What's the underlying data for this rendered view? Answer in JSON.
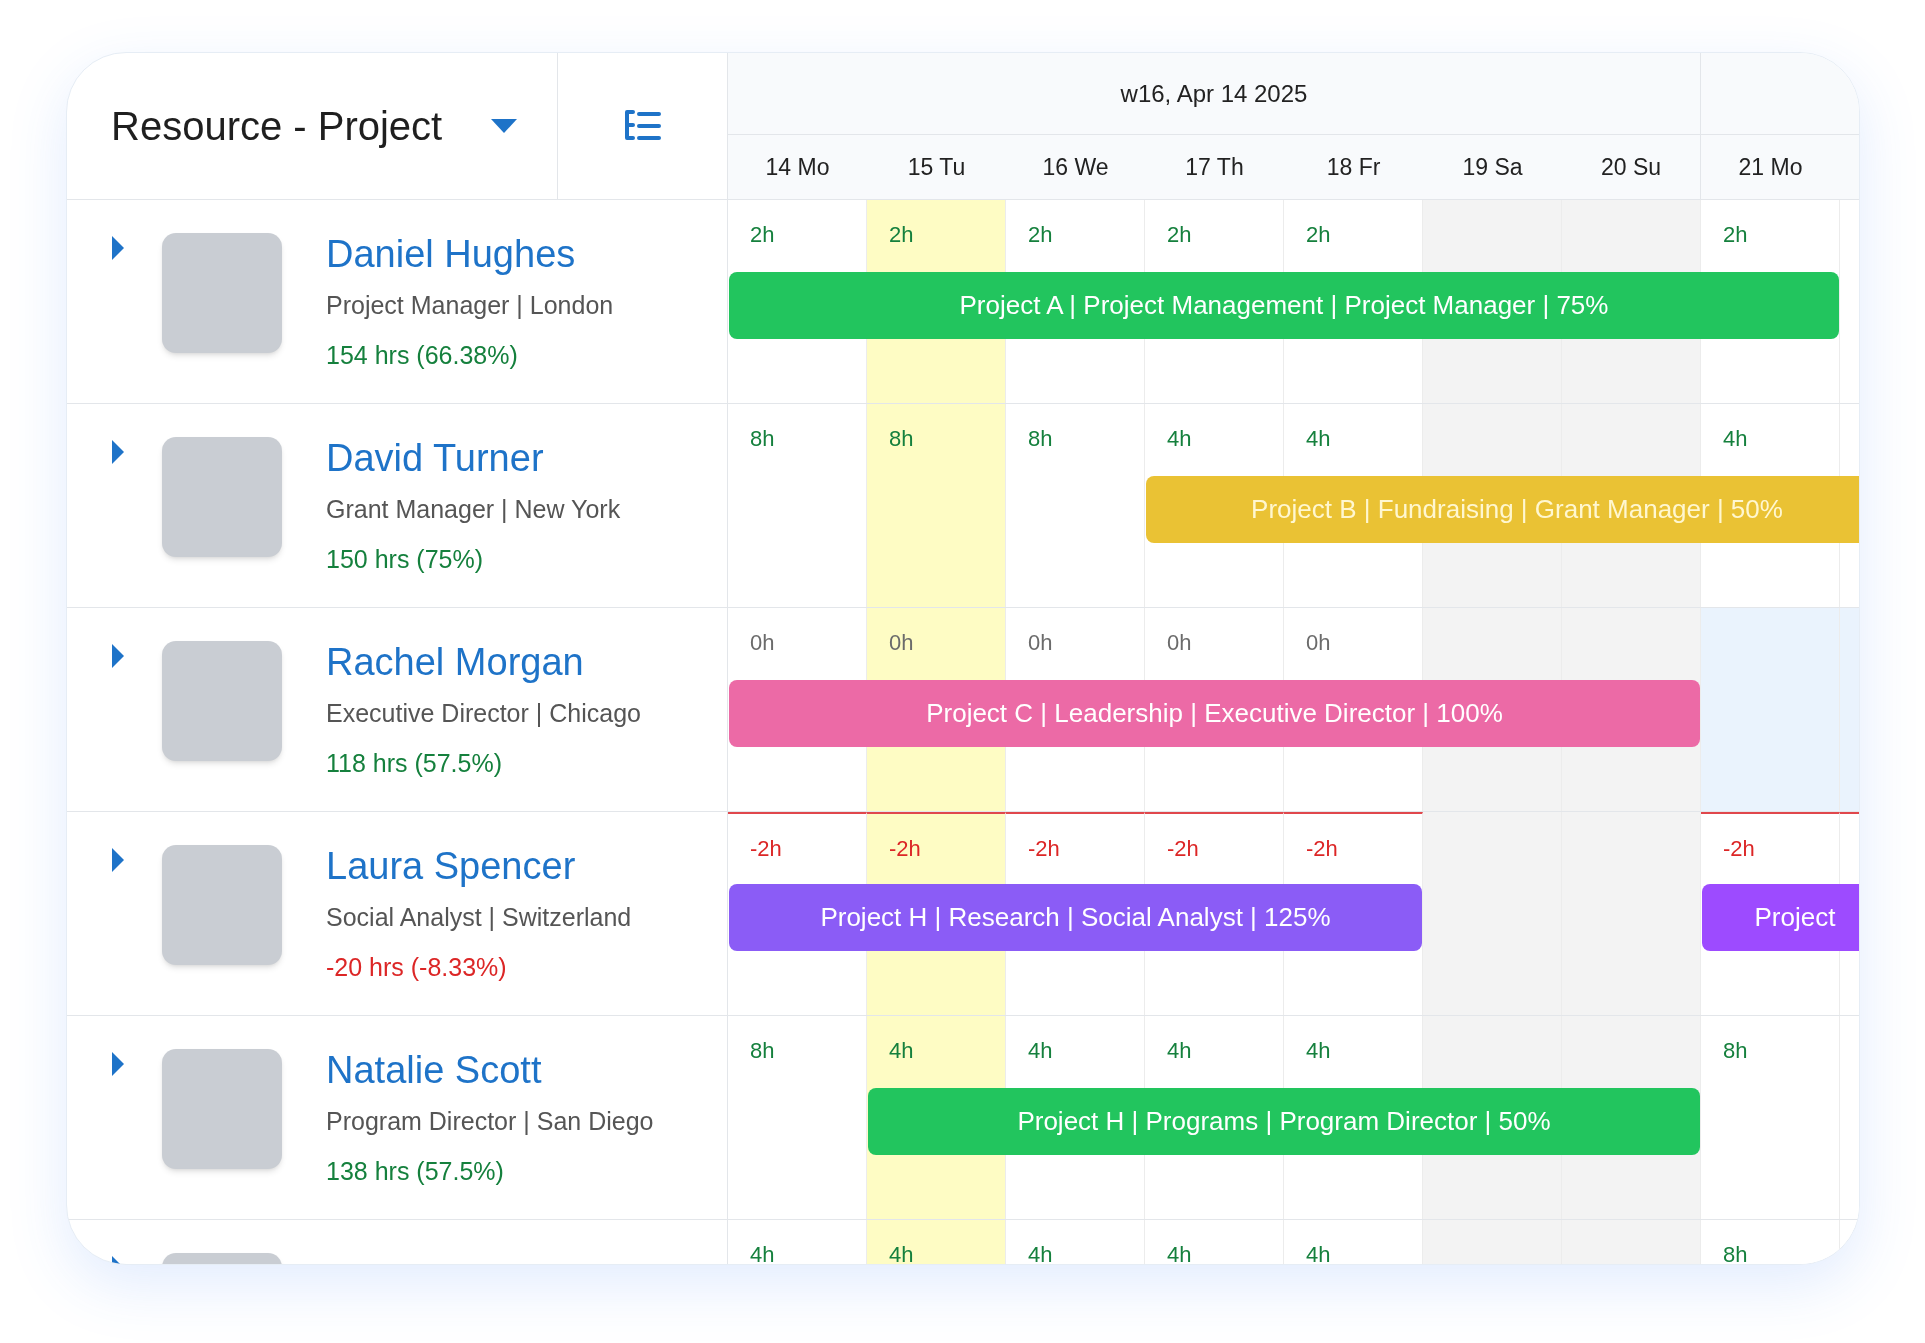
{
  "view_selector": {
    "label": "Resource - Project"
  },
  "week": {
    "label": "w16, Apr 14 2025"
  },
  "days": [
    {
      "label": "14 Mo",
      "kind": "weekday"
    },
    {
      "label": "15 Tu",
      "kind": "today"
    },
    {
      "label": "16 We",
      "kind": "weekday"
    },
    {
      "label": "17 Th",
      "kind": "weekday"
    },
    {
      "label": "18 Fr",
      "kind": "weekday"
    },
    {
      "label": "19 Sa",
      "kind": "weekend"
    },
    {
      "label": "20 Su",
      "kind": "weekend"
    },
    {
      "label": "21 Mo",
      "kind": "weekday"
    },
    {
      "kind": "weekday"
    }
  ],
  "resources": [
    {
      "name": "Daniel Hughes",
      "role": "Project Manager | London",
      "summary": "154 hrs (66.38%)",
      "expanded": false,
      "unbooked": false,
      "over_allocated": false,
      "cells": [
        {
          "hours": "2h"
        },
        {
          "hours": "2h"
        },
        {
          "hours": "2h"
        },
        {
          "hours": "2h"
        },
        {
          "hours": "2h"
        },
        {},
        {},
        {
          "hours": "2h"
        },
        {}
      ],
      "bars": [
        {
          "label": "Project A | Project Management | Project Manager | 75%",
          "color": "#22c55e",
          "days": [
            true,
            true,
            true,
            true,
            true,
            true,
            true,
            true,
            false
          ]
        }
      ]
    },
    {
      "name": "David Turner",
      "role": "Grant Manager | New York",
      "summary": "150 hrs (75%)",
      "expanded": false,
      "unbooked": false,
      "over_allocated": false,
      "cells": [
        {
          "hours": "8h"
        },
        {
          "hours": "8h"
        },
        {
          "hours": "8h"
        },
        {
          "hours": "4h"
        },
        {
          "hours": "4h"
        },
        {},
        {},
        {
          "hours": "4h"
        },
        {}
      ],
      "bars": [
        {
          "label": "Project B | Fundraising | Grant Manager | 50%",
          "color": "#eac234",
          "days": [
            false,
            false,
            false,
            true,
            true,
            true,
            true,
            true,
            true
          ]
        }
      ]
    },
    {
      "name": "Rachel Morgan",
      "role": "Executive Director | Chicago",
      "summary": "118 hrs (57.5%)",
      "expanded": false,
      "unbooked": true,
      "over_allocated": false,
      "cells": [
        {
          "hours": "0h"
        },
        {
          "hours": "0h"
        },
        {
          "hours": "0h"
        },
        {
          "hours": "0h"
        },
        {
          "hours": "0h"
        },
        {},
        {},
        {
          "highlighted": true
        },
        {
          "highlighted": true
        }
      ],
      "bars": [
        {
          "label": "Project C | Leadership | Executive Director | 100%",
          "color": "#ec6aa6",
          "days": [
            true,
            true,
            true,
            true,
            true,
            true,
            true,
            false,
            false
          ]
        }
      ]
    },
    {
      "name": "Laura Spencer",
      "role": "Social Analyst | Switzerland",
      "summary": "-20 hrs (-8.33%)",
      "expanded": false,
      "unbooked": false,
      "over_allocated": true,
      "cells": [
        {
          "hours": "-2h"
        },
        {
          "hours": "-2h"
        },
        {
          "hours": "-2h"
        },
        {
          "hours": "-2h"
        },
        {
          "hours": "-2h"
        },
        {},
        {},
        {
          "hours": "-2h"
        },
        {}
      ],
      "bars": [
        {
          "label": "Project H | Research | Social Analyst | 125%",
          "color": "#8b5cf6",
          "days": [
            true,
            true,
            true,
            true,
            true,
            false,
            false,
            false,
            false
          ]
        },
        {
          "label": "Project",
          "color": "#9d4bff",
          "days": [
            false,
            false,
            false,
            false,
            false,
            false,
            false,
            true,
            true
          ]
        }
      ]
    },
    {
      "name": "Natalie Scott",
      "role": "Program Director | San Diego",
      "summary": "138 hrs (57.5%)",
      "expanded": false,
      "unbooked": false,
      "over_allocated": false,
      "cells": [
        {
          "hours": "8h"
        },
        {
          "hours": "4h"
        },
        {
          "hours": "4h"
        },
        {
          "hours": "4h"
        },
        {
          "hours": "4h"
        },
        {},
        {},
        {
          "hours": "8h"
        },
        {}
      ],
      "bars": [
        {
          "label": "Project H | Programs | Program Director | 50%",
          "color": "#22c55e",
          "days": [
            false,
            true,
            true,
            true,
            true,
            true,
            true,
            false,
            false
          ]
        }
      ]
    },
    {
      "expanded": false,
      "unbooked": false,
      "over_allocated": false,
      "cells": [
        {
          "hours": "4h"
        },
        {
          "hours": "4h"
        },
        {
          "hours": "4h"
        },
        {
          "hours": "4h"
        },
        {
          "hours": "4h"
        },
        {},
        {},
        {
          "hours": "8h"
        },
        {}
      ]
    }
  ]
}
